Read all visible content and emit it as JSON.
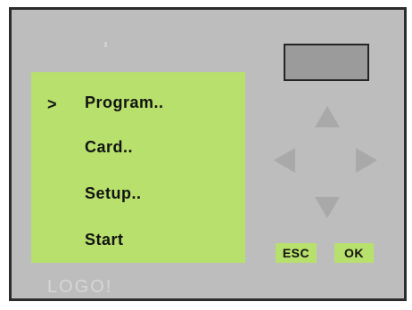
{
  "menu": {
    "cursor": ">",
    "items": [
      {
        "label": "Program.."
      },
      {
        "label": "Card.."
      },
      {
        "label": "Setup.."
      },
      {
        "label": "Start"
      }
    ]
  },
  "buttons": {
    "esc_label": "ESC",
    "ok_label": "OK"
  },
  "branding": {
    "logo_text": "LOGO!"
  },
  "colors": {
    "lcd_background": "#b7e06c",
    "device_body": "#bdbdbd",
    "border": "#2c2c2c"
  },
  "icons": {
    "up": "arrow-up-icon",
    "down": "arrow-down-icon",
    "left": "arrow-left-icon",
    "right": "arrow-right-icon"
  }
}
